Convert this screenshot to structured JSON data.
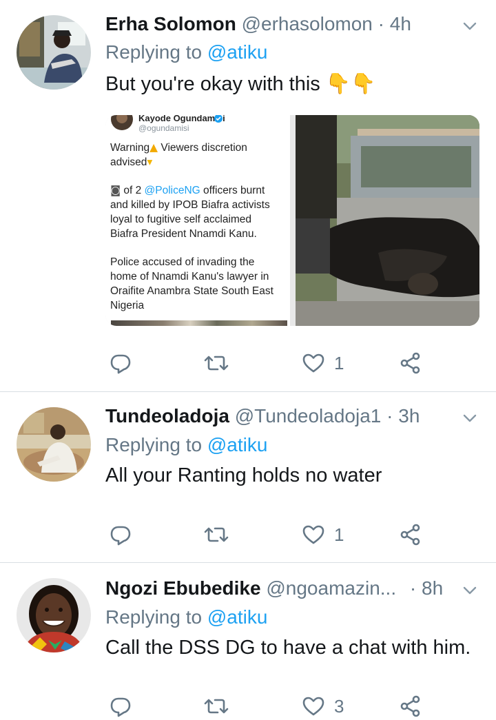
{
  "tweets": [
    {
      "name": "Erha Solomon",
      "handle": "@erhasolomon",
      "time": "· 4h",
      "replying_prefix": "Replying to",
      "replying_to": "@atiku",
      "text": "But you're okay with this",
      "emoji": "👇👇",
      "retweet_count": "",
      "like_count": "1",
      "media": {
        "embedded_name": "Kayode Ogundamisi",
        "embedded_handle": "@ogundamisi",
        "embedded_lines": [
          {
            "pre": "Warning",
            "mid": "",
            "post": " Viewers discretion"
          },
          {
            "pre": "advised",
            "mid": "",
            "post": ""
          }
        ],
        "line2_prefix": "of 2 ",
        "line2_link": "@PoliceNG",
        "line2_suffix": " officers burnt",
        "line3": "and killed by IPOB Biafra activists",
        "line4": "loyal to fugitive self acclaimed",
        "line5": "Biafra President Nnamdi Kanu.",
        "para2_1": "Police accused of invading the",
        "para2_2": "home of Nnamdi Kanu's lawyer in",
        "para2_3": "Oraifite Anambra State South East",
        "para2_4": "Nigeria"
      }
    },
    {
      "name": "Tundeoladoja",
      "handle": "@Tundeoladoja1",
      "time": "· 3h",
      "replying_prefix": "Replying to",
      "replying_to": "@atiku",
      "text": "All your Ranting holds no water",
      "like_count": "1"
    },
    {
      "name": "Ngozi Ebubedike",
      "handle": "@ngoamazin...",
      "time": "· 8h",
      "replying_prefix": "Replying to",
      "replying_to": "@atiku",
      "text": "Call the DSS DG to have a chat with him.",
      "like_count": "3"
    }
  ],
  "colors": {
    "accent": "#1da1f2",
    "muted": "#657786",
    "text": "#14171a",
    "divider": "#d8dee3"
  },
  "icons": [
    "reply-icon",
    "retweet-icon",
    "like-icon",
    "share-icon",
    "chevron-down-icon"
  ]
}
